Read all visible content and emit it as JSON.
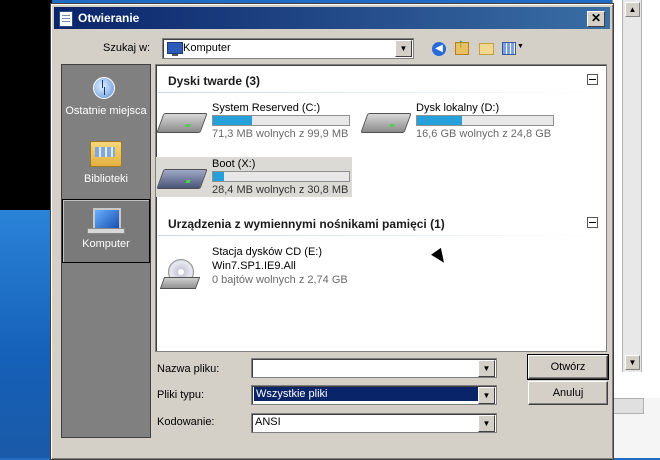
{
  "dialog": {
    "title": "Otwieranie",
    "close": "✕"
  },
  "toolbar": {
    "lookin_label": "Szukaj w:",
    "lookin_value": "Komputer",
    "dropdown_arrow": "▼"
  },
  "places": [
    {
      "label": "Ostatnie miejsca",
      "icon": "recent-places-icon"
    },
    {
      "label": "Biblioteki",
      "icon": "libraries-icon"
    },
    {
      "label": "Komputer",
      "icon": "computer-icon",
      "selected": true
    }
  ],
  "groups": {
    "hard_drives": {
      "title": "Dyski twarde (3)",
      "drives": [
        {
          "name": "System Reserved (C:)",
          "info": "71,3 MB wolnych z 99,9 MB",
          "used_fraction": 0.29
        },
        {
          "name": "Dysk lokalny (D:)",
          "info": "16,6 GB wolnych z 24,8 GB",
          "used_fraction": 0.33
        },
        {
          "name": "Boot (X:)",
          "info": "28,4 MB wolnych z 30,8 MB",
          "used_fraction": 0.08,
          "selected": true
        }
      ]
    },
    "removable": {
      "title": "Urządzenia z wymiennymi nośnikami pamięci (1)",
      "drives": [
        {
          "name": "Stacja dysków CD (E:)",
          "label": "Win7.SP1.IE9.All",
          "info": "0 bajtów wolnych z 2,74 GB"
        }
      ]
    }
  },
  "form": {
    "filename_label": "Nazwa pliku:",
    "filename_value": "",
    "filetype_label": "Pliki typu:",
    "filetype_value": "Wszystkie pliki",
    "encoding_label": "Kodowanie:",
    "encoding_value": "ANSI"
  },
  "buttons": {
    "open": "Otwórz",
    "cancel": "Anuluj"
  },
  "colors": {
    "title_start": "#0a246a",
    "title_end": "#3a6ea5",
    "usage_bar": "#26a0da",
    "selection": "#dcdad5"
  }
}
